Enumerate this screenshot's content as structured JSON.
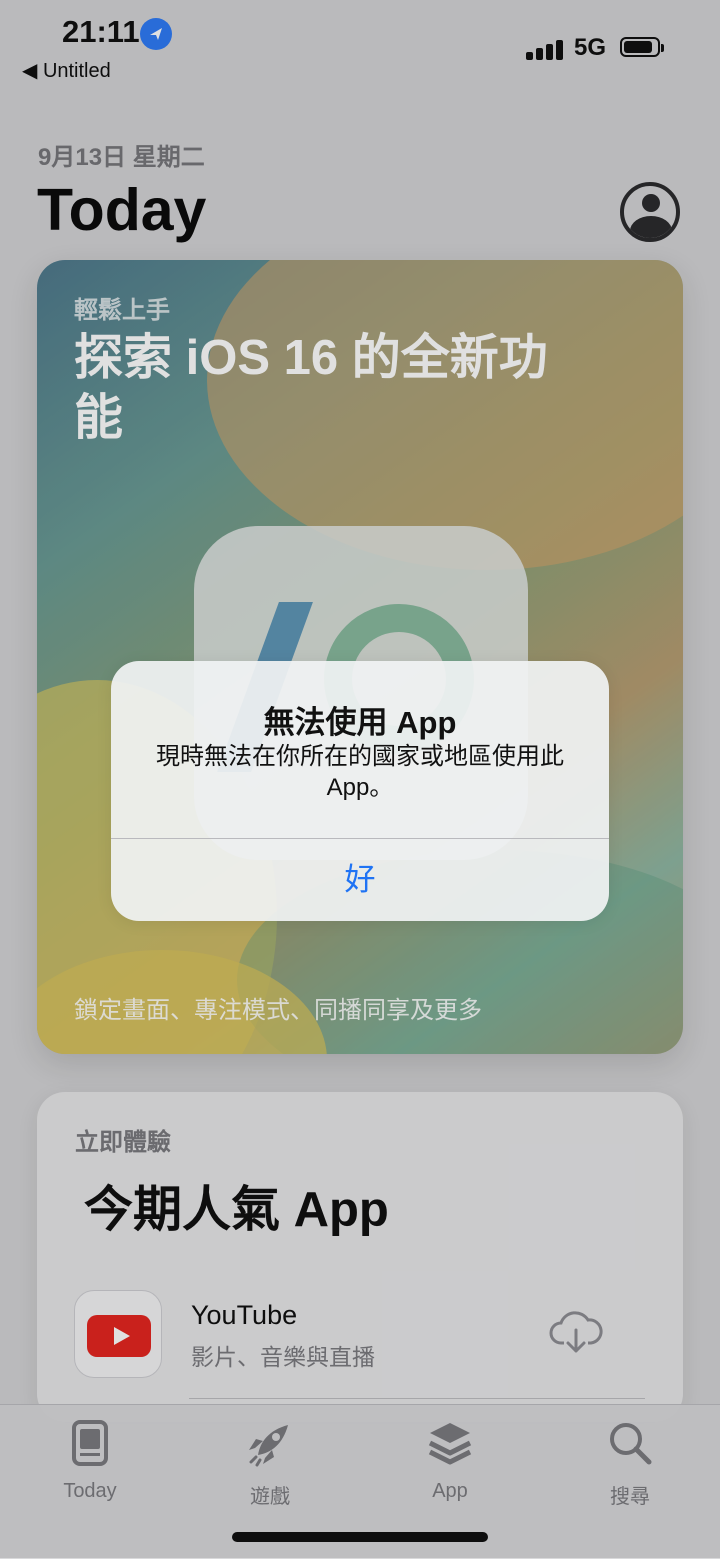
{
  "status_bar": {
    "time": "21:11",
    "back_label": "◀ Untitled",
    "network": "5G"
  },
  "header": {
    "date": "9月13日 星期二",
    "title": "Today"
  },
  "feature_card": {
    "eyebrow": "輕鬆上手",
    "headline": "探索 iOS 16 的全新功能",
    "footer": "鎖定畫面、專注模式、同播同享及更多"
  },
  "popular_card": {
    "eyebrow": "立即體驗",
    "title": "今期人氣 App",
    "app_name": "YouTube",
    "app_subtitle": "影片、音樂與直播"
  },
  "alert": {
    "title": "無法使用 App",
    "message": "現時無法在你所在的國家或地區使用此 App。",
    "button": "好"
  },
  "tabs": [
    {
      "label": "Today"
    },
    {
      "label": "遊戲"
    },
    {
      "label": "App"
    },
    {
      "label": "搜尋"
    }
  ]
}
